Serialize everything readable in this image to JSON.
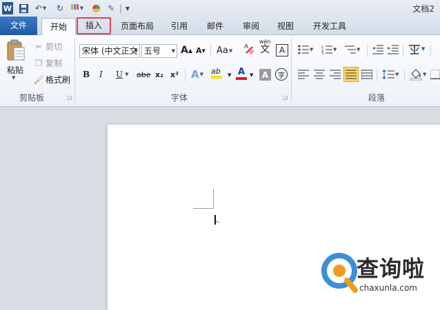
{
  "window": {
    "title": "文档2"
  },
  "quick_access": {
    "separator": "|"
  },
  "tabs": [
    {
      "label": "文件"
    },
    {
      "label": "开始"
    },
    {
      "label": "插入"
    },
    {
      "label": "页面布局"
    },
    {
      "label": "引用"
    },
    {
      "label": "邮件"
    },
    {
      "label": "审阅"
    },
    {
      "label": "视图"
    },
    {
      "label": "开发工具"
    }
  ],
  "clipboard": {
    "paste": "粘贴",
    "cut": "剪切",
    "copy": "复制",
    "format_painter": "格式刷",
    "group_label": "剪贴板"
  },
  "font": {
    "font_name": "宋体 (中文正文",
    "font_size": "五号",
    "grow": "A",
    "shrink": "A",
    "change_case": "Aa",
    "bold": "B",
    "italic": "I",
    "underline": "U",
    "strike": "abe",
    "subscript": "x₂",
    "superscript": "x²",
    "text_effect": "A",
    "highlight": "ab",
    "font_color": "A",
    "char_shading": "A",
    "enclose": "字",
    "wen": "wén",
    "wen_char": "文",
    "group_label": "字体"
  },
  "paragraph": {
    "group_label": "段落"
  },
  "watermark": {
    "name": "查询啦",
    "url": "chaxunla.com"
  },
  "colors": {
    "file_tab": "#2a66b5",
    "insert_highlight": "#d8474a",
    "accent_orange": "#f39a1e",
    "accent_blue": "#3a8fd8"
  }
}
